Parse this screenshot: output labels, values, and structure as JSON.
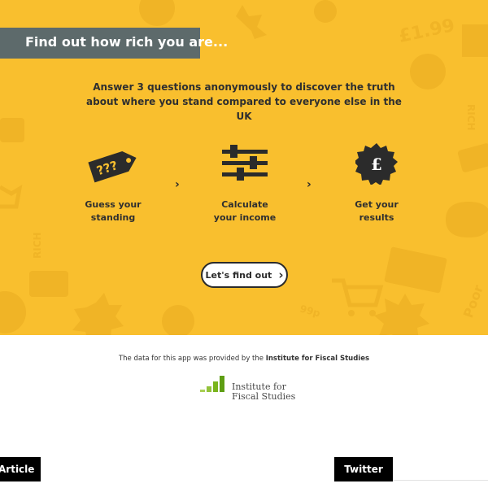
{
  "hero": {
    "title": "Find out how rich you are...",
    "intro": "Answer 3 questions anonymously to discover the truth about where you stand compared to everyone else in the UK",
    "steps": [
      {
        "line1": "Guess your",
        "line2": "standing",
        "icon": "price-tag-icon",
        "tag_text": "???"
      },
      {
        "line1": "Calculate",
        "line2": "your income",
        "icon": "sliders-icon"
      },
      {
        "line1": "Get your",
        "line2": "results",
        "icon": "pound-badge-icon",
        "badge_text": "£"
      }
    ],
    "cta_label": "Let's find out",
    "background_words": {
      "price": "£1.99",
      "rich1": "RICH",
      "rich2": "RICH",
      "poor": "Poor",
      "pence": "99p"
    }
  },
  "credit": {
    "prefix": "The data for this app was provided by the ",
    "org": "Institute for Fiscal Studies"
  },
  "ifs_logo": {
    "line1": "Institute for",
    "line2": "Fiscal Studies"
  },
  "footer_tabs": {
    "article": "Article",
    "twitter": "Twitter"
  },
  "colors": {
    "hero_bg": "#f9bf2e",
    "title_bar": "#5d6a6b",
    "ifs_green": "#7ab51d",
    "dark": "#2b2b2b"
  }
}
